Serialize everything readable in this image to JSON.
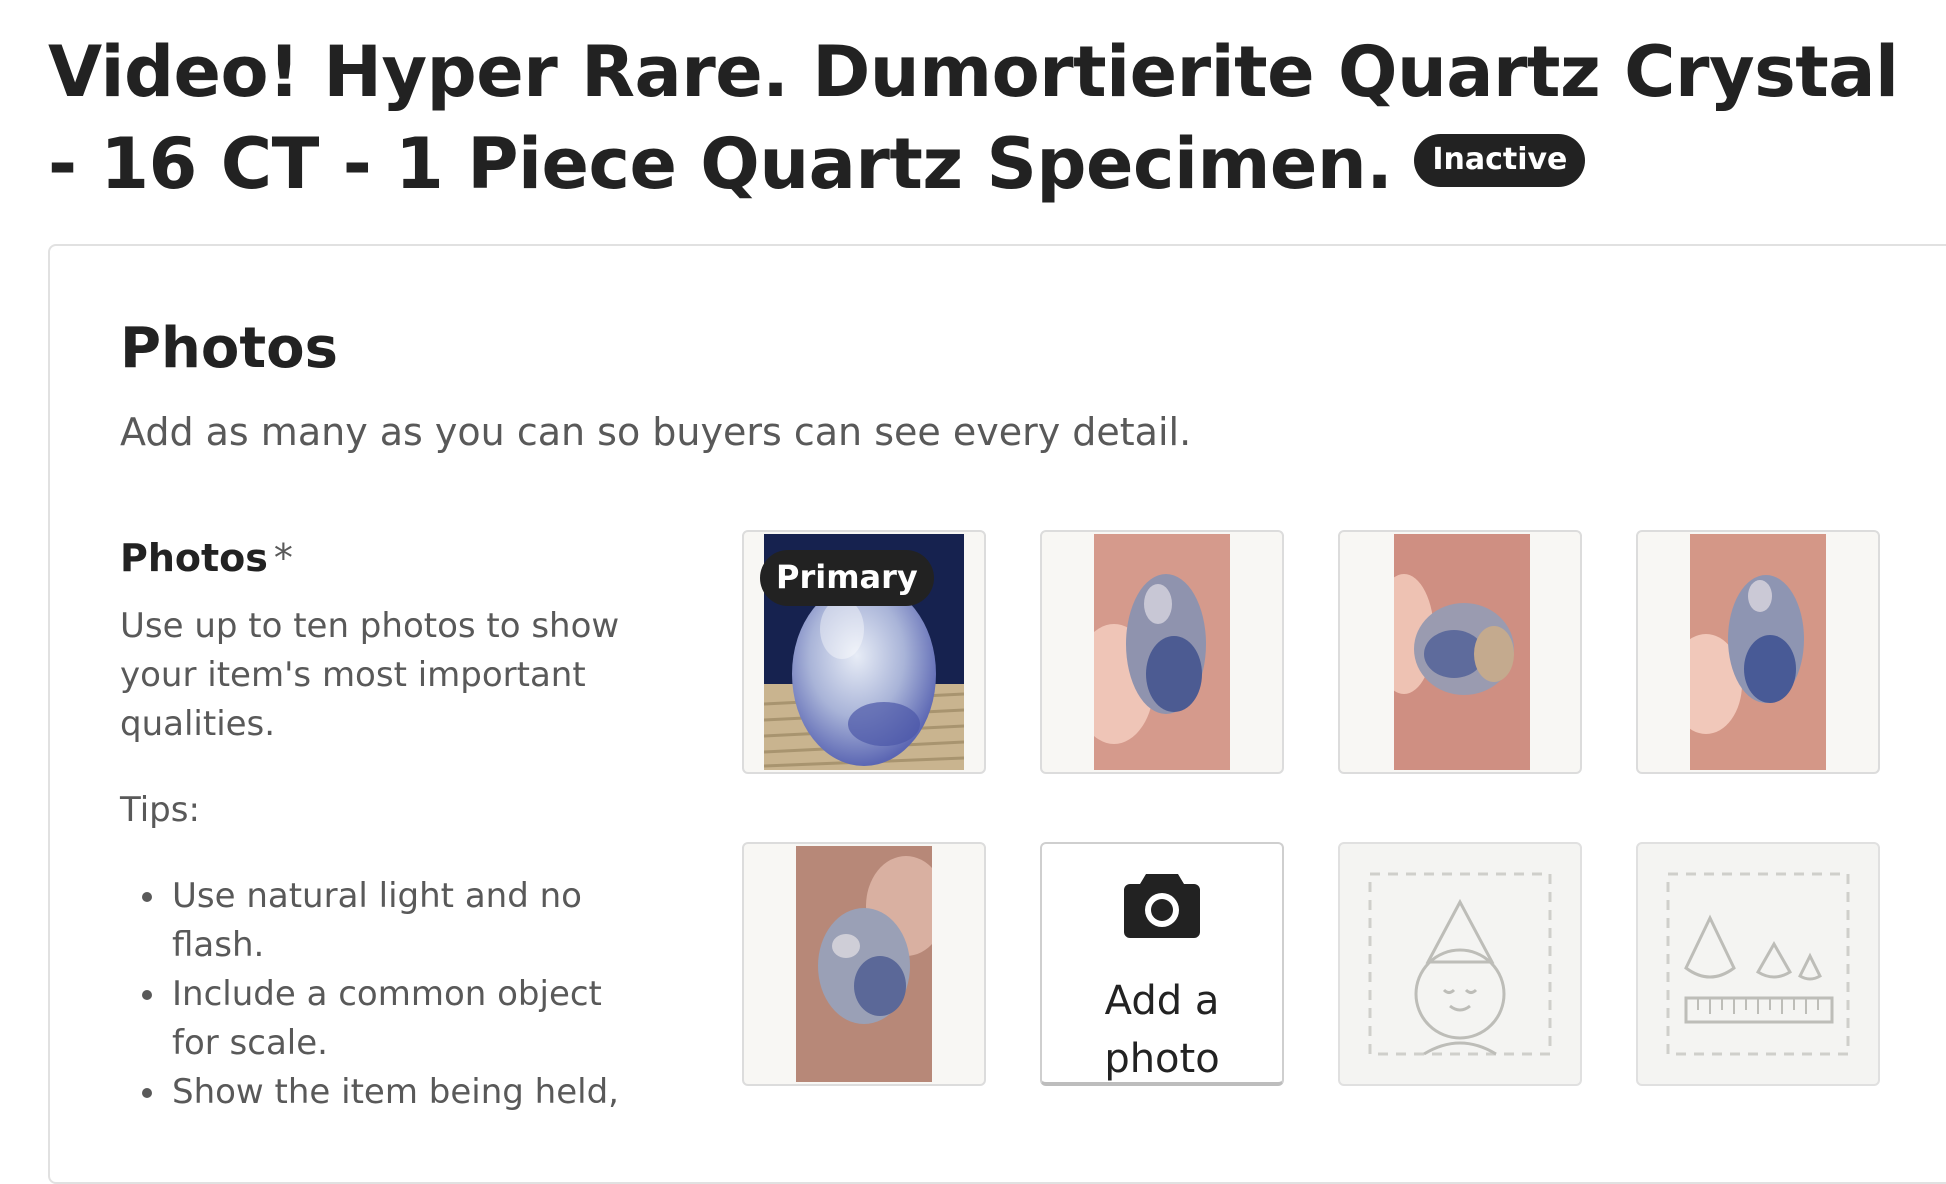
{
  "listing": {
    "title": "Video! Hyper Rare. Dumortierite Quartz Crystal - 16 CT - 1 Piece Quartz Specimen.",
    "status": "Inactive"
  },
  "photos_section": {
    "title": "Photos",
    "subtitle": "Add as many as you can so buyers can see every detail.",
    "field_label": "Photos",
    "required_mark": "*",
    "help_text": "Use up to ten photos to show your item's most important qualities.",
    "tips_label": "Tips:",
    "tips": [
      "Use natural light and no flash.",
      "Include a common object for scale.",
      "Show the item being held,"
    ],
    "primary_label": "Primary",
    "add_photo_label": "Add a photo",
    "photos": [
      {
        "name": "dumortierite-quartz-photo-1",
        "primary": true
      },
      {
        "name": "dumortierite-quartz-photo-2",
        "primary": false
      },
      {
        "name": "dumortierite-quartz-photo-3",
        "primary": false
      },
      {
        "name": "dumortierite-quartz-photo-4",
        "primary": false
      },
      {
        "name": "dumortierite-quartz-photo-5",
        "primary": false
      }
    ],
    "placeholders": [
      "person-for-scale-placeholder-icon",
      "ruler-for-scale-placeholder-icon"
    ]
  },
  "colors": {
    "badge_bg": "#222222",
    "tile_border": "#dcdcdc",
    "muted_text": "#595959"
  }
}
